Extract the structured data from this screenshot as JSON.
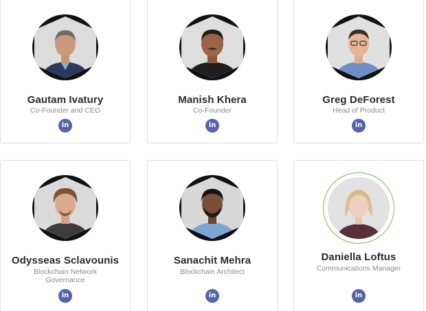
{
  "team": [
    {
      "name": "Gautam Ivatury",
      "role": "Co-Founder and CEO",
      "linkedin_label": "in",
      "avatar_icon": "person-photo"
    },
    {
      "name": "Manish Khera",
      "role": "Co-Founder",
      "linkedin_label": "in",
      "avatar_icon": "person-photo"
    },
    {
      "name": "Greg DeForest",
      "role": "Head of Product",
      "linkedin_label": "in",
      "avatar_icon": "person-photo"
    },
    {
      "name": "Odysseas Sclavounis",
      "role": "Blockchain Network Governance",
      "linkedin_label": "in",
      "avatar_icon": "person-photo"
    },
    {
      "name": "Sanachit Mehra",
      "role": "Blockchain Architect",
      "linkedin_label": "in",
      "avatar_icon": "person-photo"
    },
    {
      "name": "Daniella Loftus",
      "role": "Communications Manager",
      "linkedin_label": "in",
      "avatar_icon": "person-photo"
    }
  ],
  "colors": {
    "linkedin_button": "#5563ad",
    "highlight_ring": "#6ac04a",
    "card_border": "#e2e2e2",
    "name_text": "#2b2b2b",
    "role_text": "#8a8a8a"
  }
}
